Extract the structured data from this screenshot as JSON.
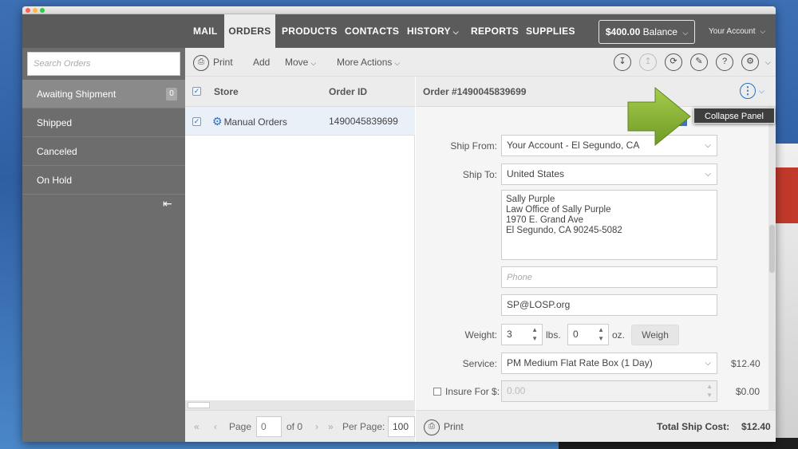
{
  "colors": {
    "nav_bg": "#5b5b5b",
    "sidebar_bg": "#6d6d6d",
    "accent_blue": "#2a6fc1",
    "arrow_green": "#86b43a",
    "popup_bg": "#3e3e3e"
  },
  "topnav": {
    "items": [
      {
        "label": "MAIL",
        "active": false
      },
      {
        "label": "ORDERS",
        "active": true
      },
      {
        "label": "PRODUCTS",
        "active": false
      },
      {
        "label": "CONTACTS",
        "active": false
      },
      {
        "label": "HISTORY",
        "active": false,
        "dropdown": true
      },
      {
        "label": "REPORTS",
        "active": false
      },
      {
        "label": "SUPPLIES",
        "active": false
      }
    ],
    "balance_amount": "$400.00",
    "balance_label": "Balance",
    "account_label": "Your Account"
  },
  "sidebar": {
    "search_placeholder": "Search Orders",
    "items": [
      {
        "label": "Awaiting Shipment",
        "count": "0",
        "active": true
      },
      {
        "label": "Shipped"
      },
      {
        "label": "Canceled"
      },
      {
        "label": "On Hold"
      }
    ],
    "collapse_icon": "collapse-left-icon"
  },
  "toolbar": {
    "print": "Print",
    "add": "Add",
    "move": "Move",
    "more_actions": "More Actions",
    "icons": [
      "import-icon",
      "export-icon",
      "refresh-icon",
      "tag-icon",
      "help-icon",
      "settings-icon"
    ]
  },
  "order_list": {
    "headers": {
      "store": "Store",
      "order_id": "Order ID"
    },
    "rows": [
      {
        "store": "Manual Orders",
        "order_id": "1490045839699",
        "checked": true
      }
    ]
  },
  "pager": {
    "page_label": "Page",
    "page_value": "0",
    "of_label": "of 0",
    "per_page_label": "Per Page:",
    "per_page_value": "100"
  },
  "detail": {
    "title": "Order #1490045839699",
    "menu_item": "Collapse Panel",
    "ship_from_label": "Ship From:",
    "ship_from_value": "Your Account - El Segundo, CA",
    "ship_to_label": "Ship To:",
    "ship_to_value": "United States",
    "address_lines": [
      "Sally Purple",
      "Law Office of Sally Purple",
      "1970 E. Grand Ave",
      "El Segundo, CA 90245-5082"
    ],
    "phone_placeholder": "Phone",
    "email": "SP@LOSP.org",
    "weight_label": "Weight:",
    "weight_lbs": "3",
    "lbs_unit": "lbs.",
    "weight_oz": "0",
    "oz_unit": "oz.",
    "weigh_button": "Weigh",
    "service_label": "Service:",
    "service_value": "PM Medium Flat Rate Box (1 Day)",
    "service_price": "$12.40",
    "insure_label": "Insure For $:",
    "insure_placeholder": "0.00",
    "insure_price": "$0.00",
    "print": "Print",
    "total_label": "Total Ship Cost:",
    "total_value": "$12.40"
  }
}
